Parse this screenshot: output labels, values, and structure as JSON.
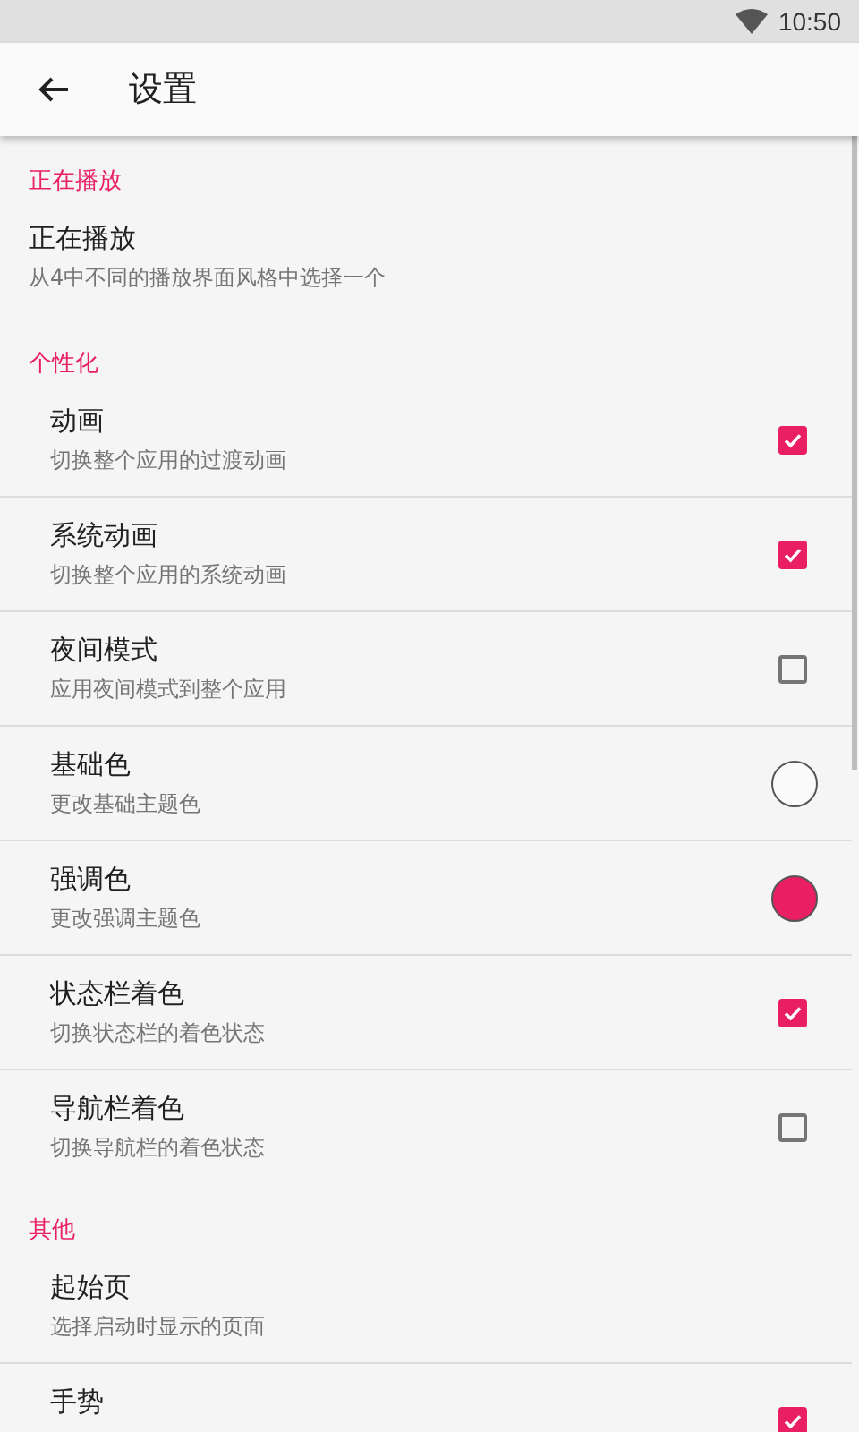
{
  "status_bar": {
    "time": "10:50"
  },
  "toolbar": {
    "title": "设置"
  },
  "sections": [
    {
      "title": "正在播放",
      "items": [
        {
          "title": "正在播放",
          "subtitle": "从4中不同的播放界面风格中选择一个",
          "kind": "plain"
        }
      ]
    },
    {
      "title": "个性化",
      "items": [
        {
          "title": "动画",
          "subtitle": "切换整个应用的过渡动画",
          "kind": "checkbox",
          "checked": true
        },
        {
          "title": "系统动画",
          "subtitle": "切换整个应用的系统动画",
          "kind": "checkbox",
          "checked": true
        },
        {
          "title": "夜间模式",
          "subtitle": "应用夜间模式到整个应用",
          "kind": "checkbox",
          "checked": false
        },
        {
          "title": "基础色",
          "subtitle": "更改基础主题色",
          "kind": "color",
          "color": "#fafafa"
        },
        {
          "title": "强调色",
          "subtitle": "更改强调主题色",
          "kind": "color",
          "color": "#e91e63"
        },
        {
          "title": "状态栏着色",
          "subtitle": "切换状态栏的着色状态",
          "kind": "checkbox",
          "checked": true
        },
        {
          "title": "导航栏着色",
          "subtitle": "切换导航栏的着色状态",
          "kind": "checkbox",
          "checked": false
        }
      ]
    },
    {
      "title": "其他",
      "items": [
        {
          "title": "起始页",
          "subtitle": "选择启动时显示的页面",
          "kind": "plain"
        },
        {
          "title": "手势",
          "kind": "checkbox",
          "checked": true
        }
      ]
    }
  ]
}
